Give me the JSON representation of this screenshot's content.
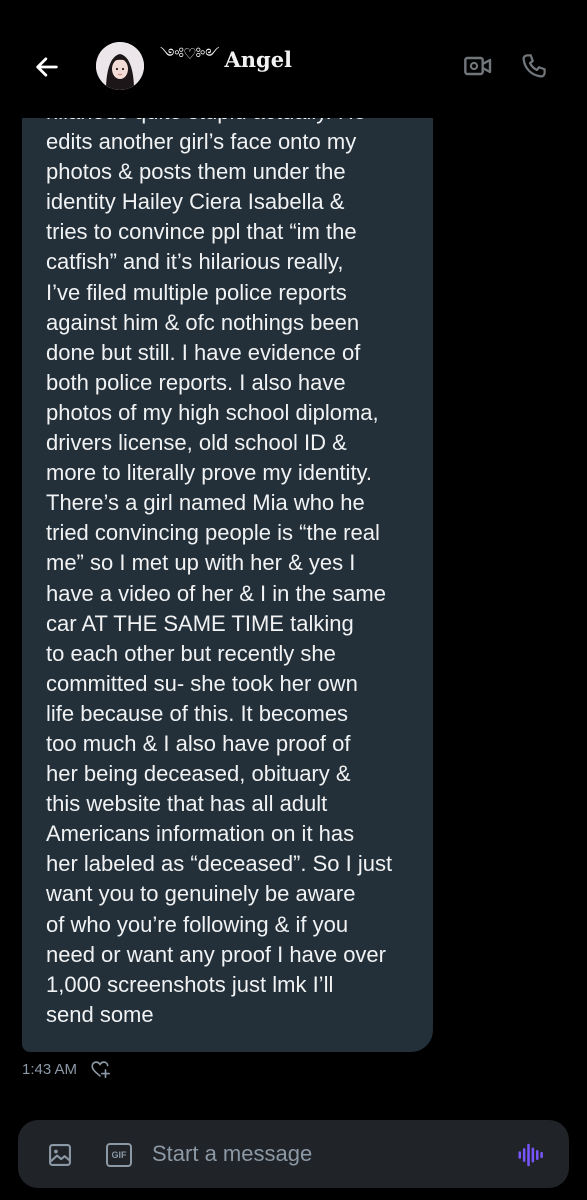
{
  "header": {
    "name": "Angel",
    "name_ornament": "༺♡༻",
    "back_icon": "arrow-left-icon",
    "video_icon": "video-camera-icon",
    "call_icon": "phone-icon"
  },
  "message": {
    "lines": [
      "hilarious quite stupid actually. He",
      "edits another girl’s face onto my",
      "photos & posts them under the",
      "identity Hailey Ciera Isabella &",
      "tries to convince ppl that “im the",
      "catfish” and it’s hilarious really,",
      "I’ve filed multiple police reports",
      "against him & ofc nothings been",
      "done but still. I have evidence of",
      "both police reports. I also have",
      "photos of my high school diploma,",
      "drivers license, old school ID &",
      "more to literally prove my identity.",
      "There’s a girl named Mia who he",
      "tried convincing people is “the real",
      "me” so I met up with her & yes I",
      "have a video of her & I in the same",
      "car AT THE SAME TIME talking",
      "to each other but recently she",
      "committed su- she took her own",
      "life because of this. It becomes",
      "too much & I also have proof of",
      "her being deceased, obituary &",
      "this website that has all adult",
      "Americans information on it has",
      "her labeled as “deceased”. So I just",
      "want you to genuinely be aware",
      "of who you’re following & if you",
      "need or want any proof I have over",
      "1,000 screenshots just lmk I’ll",
      "send some"
    ],
    "time": "1:43 AM",
    "react_icon": "heart-plus-icon"
  },
  "composer": {
    "placeholder": "Start a message",
    "gif_label": "GIF",
    "image_icon": "image-icon",
    "voice_icon": "voice-wave-icon",
    "accent_color": "#7856ff"
  }
}
